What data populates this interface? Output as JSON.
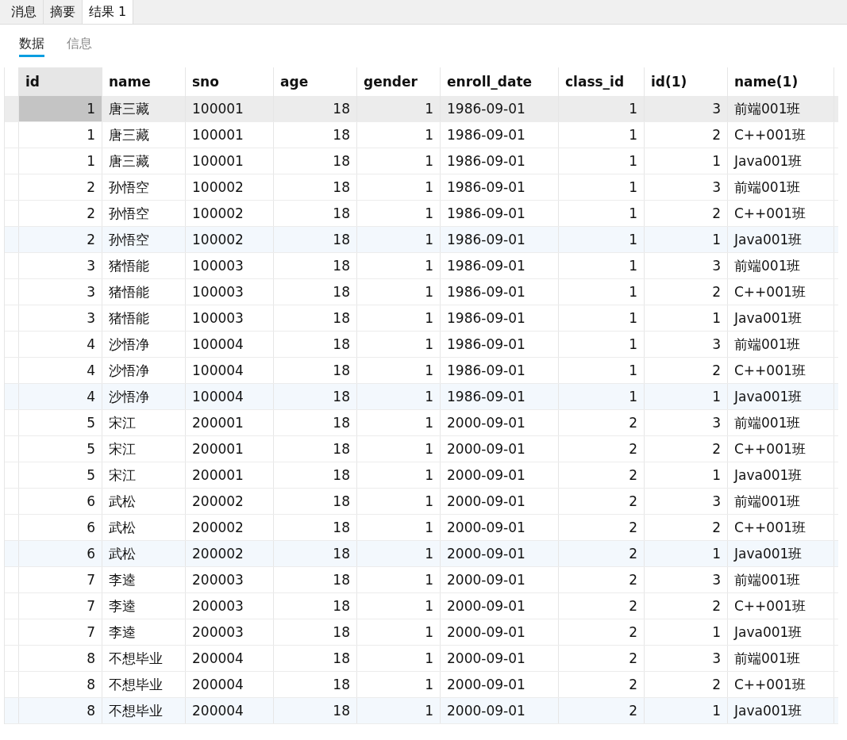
{
  "tabs": [
    {
      "label": "消息",
      "selected": false
    },
    {
      "label": "摘要",
      "selected": false
    },
    {
      "label": "结果 1",
      "selected": true
    }
  ],
  "subtabs": [
    {
      "label": "数据",
      "selected": true
    },
    {
      "label": "信息",
      "selected": false
    }
  ],
  "table": {
    "columns": [
      {
        "label": "id",
        "kind": "number"
      },
      {
        "label": "name",
        "kind": "text"
      },
      {
        "label": "sno",
        "kind": "text"
      },
      {
        "label": "age",
        "kind": "number"
      },
      {
        "label": "gender",
        "kind": "number"
      },
      {
        "label": "enroll_date",
        "kind": "text"
      },
      {
        "label": "class_id",
        "kind": "number"
      },
      {
        "label": "id(1)",
        "kind": "number"
      },
      {
        "label": "name(1)",
        "kind": "text"
      }
    ],
    "rows": [
      {
        "selected": true,
        "tinted": false,
        "cells": [
          "1",
          "唐三藏",
          "100001",
          "18",
          "1",
          "1986-09-01",
          "1",
          "3",
          "前端001班"
        ]
      },
      {
        "selected": false,
        "tinted": false,
        "cells": [
          "1",
          "唐三藏",
          "100001",
          "18",
          "1",
          "1986-09-01",
          "1",
          "2",
          "C++001班"
        ]
      },
      {
        "selected": false,
        "tinted": false,
        "cells": [
          "1",
          "唐三藏",
          "100001",
          "18",
          "1",
          "1986-09-01",
          "1",
          "1",
          "Java001班"
        ]
      },
      {
        "selected": false,
        "tinted": false,
        "cells": [
          "2",
          "孙悟空",
          "100002",
          "18",
          "1",
          "1986-09-01",
          "1",
          "3",
          "前端001班"
        ]
      },
      {
        "selected": false,
        "tinted": false,
        "cells": [
          "2",
          "孙悟空",
          "100002",
          "18",
          "1",
          "1986-09-01",
          "1",
          "2",
          "C++001班"
        ]
      },
      {
        "selected": false,
        "tinted": true,
        "cells": [
          "2",
          "孙悟空",
          "100002",
          "18",
          "1",
          "1986-09-01",
          "1",
          "1",
          "Java001班"
        ]
      },
      {
        "selected": false,
        "tinted": false,
        "cells": [
          "3",
          "猪悟能",
          "100003",
          "18",
          "1",
          "1986-09-01",
          "1",
          "3",
          "前端001班"
        ]
      },
      {
        "selected": false,
        "tinted": false,
        "cells": [
          "3",
          "猪悟能",
          "100003",
          "18",
          "1",
          "1986-09-01",
          "1",
          "2",
          "C++001班"
        ]
      },
      {
        "selected": false,
        "tinted": false,
        "cells": [
          "3",
          "猪悟能",
          "100003",
          "18",
          "1",
          "1986-09-01",
          "1",
          "1",
          "Java001班"
        ]
      },
      {
        "selected": false,
        "tinted": false,
        "cells": [
          "4",
          "沙悟净",
          "100004",
          "18",
          "1",
          "1986-09-01",
          "1",
          "3",
          "前端001班"
        ]
      },
      {
        "selected": false,
        "tinted": false,
        "cells": [
          "4",
          "沙悟净",
          "100004",
          "18",
          "1",
          "1986-09-01",
          "1",
          "2",
          "C++001班"
        ]
      },
      {
        "selected": false,
        "tinted": true,
        "cells": [
          "4",
          "沙悟净",
          "100004",
          "18",
          "1",
          "1986-09-01",
          "1",
          "1",
          "Java001班"
        ]
      },
      {
        "selected": false,
        "tinted": false,
        "cells": [
          "5",
          "宋江",
          "200001",
          "18",
          "1",
          "2000-09-01",
          "2",
          "3",
          "前端001班"
        ]
      },
      {
        "selected": false,
        "tinted": false,
        "cells": [
          "5",
          "宋江",
          "200001",
          "18",
          "1",
          "2000-09-01",
          "2",
          "2",
          "C++001班"
        ]
      },
      {
        "selected": false,
        "tinted": false,
        "cells": [
          "5",
          "宋江",
          "200001",
          "18",
          "1",
          "2000-09-01",
          "2",
          "1",
          "Java001班"
        ]
      },
      {
        "selected": false,
        "tinted": false,
        "cells": [
          "6",
          "武松",
          "200002",
          "18",
          "1",
          "2000-09-01",
          "2",
          "3",
          "前端001班"
        ]
      },
      {
        "selected": false,
        "tinted": false,
        "cells": [
          "6",
          "武松",
          "200002",
          "18",
          "1",
          "2000-09-01",
          "2",
          "2",
          "C++001班"
        ]
      },
      {
        "selected": false,
        "tinted": true,
        "cells": [
          "6",
          "武松",
          "200002",
          "18",
          "1",
          "2000-09-01",
          "2",
          "1",
          "Java001班"
        ]
      },
      {
        "selected": false,
        "tinted": false,
        "cells": [
          "7",
          "李逵",
          "200003",
          "18",
          "1",
          "2000-09-01",
          "2",
          "3",
          "前端001班"
        ]
      },
      {
        "selected": false,
        "tinted": false,
        "cells": [
          "7",
          "李逵",
          "200003",
          "18",
          "1",
          "2000-09-01",
          "2",
          "2",
          "C++001班"
        ]
      },
      {
        "selected": false,
        "tinted": false,
        "cells": [
          "7",
          "李逵",
          "200003",
          "18",
          "1",
          "2000-09-01",
          "2",
          "1",
          "Java001班"
        ]
      },
      {
        "selected": false,
        "tinted": false,
        "cells": [
          "8",
          "不想毕业",
          "200004",
          "18",
          "1",
          "2000-09-01",
          "2",
          "3",
          "前端001班"
        ]
      },
      {
        "selected": false,
        "tinted": false,
        "cells": [
          "8",
          "不想毕业",
          "200004",
          "18",
          "1",
          "2000-09-01",
          "2",
          "2",
          "C++001班"
        ]
      },
      {
        "selected": false,
        "tinted": true,
        "cells": [
          "8",
          "不想毕业",
          "200004",
          "18",
          "1",
          "2000-09-01",
          "2",
          "1",
          "Java001班"
        ]
      }
    ]
  }
}
